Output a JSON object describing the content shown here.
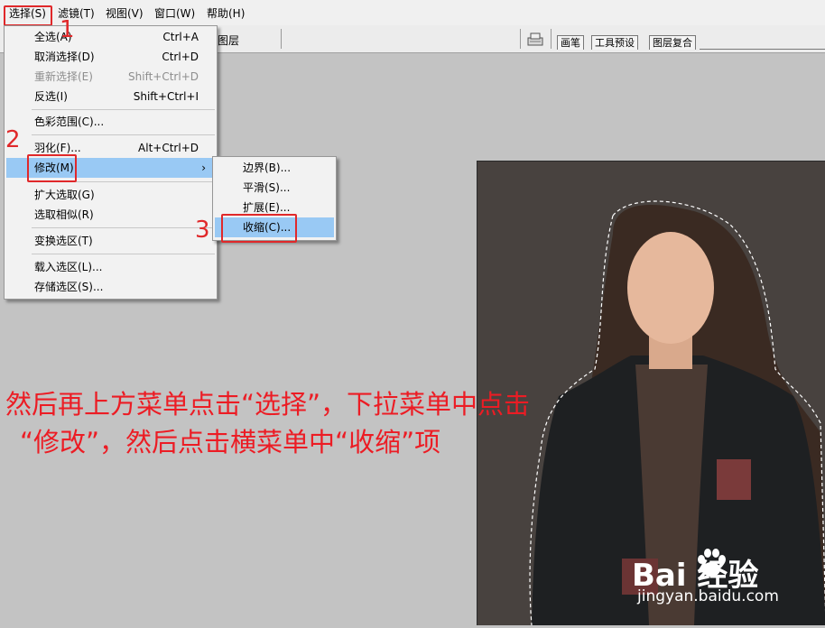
{
  "menubar": {
    "items": [
      "选择(S)",
      "滤镜(T)",
      "视图(V)",
      "窗口(W)",
      "帮助(H)"
    ]
  },
  "toolbar": {
    "layer_label": "图层",
    "panel_tabs": [
      "画笔",
      "工具预设",
      "图层复合"
    ]
  },
  "select_menu": {
    "items": [
      {
        "label": "全选(A)",
        "shortcut": "Ctrl+A",
        "disabled": false
      },
      {
        "label": "取消选择(D)",
        "shortcut": "Ctrl+D",
        "disabled": false
      },
      {
        "label": "重新选择(E)",
        "shortcut": "Shift+Ctrl+D",
        "disabled": true
      },
      {
        "label": "反选(I)",
        "shortcut": "Shift+Ctrl+I",
        "disabled": false
      },
      {
        "label": "色彩范围(C)...",
        "shortcut": "",
        "disabled": false
      },
      {
        "label": "羽化(F)...",
        "shortcut": "Alt+Ctrl+D",
        "disabled": false
      },
      {
        "label": "修改(M)",
        "shortcut": "",
        "disabled": false,
        "submenu_arrow": "›"
      },
      {
        "label": "扩大选取(G)",
        "shortcut": "",
        "disabled": false
      },
      {
        "label": "选取相似(R)",
        "shortcut": "",
        "disabled": false
      },
      {
        "label": "变换选区(T)",
        "shortcut": "",
        "disabled": false
      },
      {
        "label": "载入选区(L)...",
        "shortcut": "",
        "disabled": false
      },
      {
        "label": "存储选区(S)...",
        "shortcut": "",
        "disabled": false
      }
    ]
  },
  "modify_submenu": {
    "items": [
      "边界(B)...",
      "平滑(S)...",
      "扩展(E)...",
      "收缩(C)..."
    ]
  },
  "steps": [
    "1",
    "2",
    "3"
  ],
  "caption": {
    "line1": "然后再上方菜单点击“选择”，下拉菜单中点击",
    "line2": "“修改”，然后点击横菜单中“收缩”项"
  },
  "watermark": {
    "brand": "Bai  经验",
    "url": "jingyan.baidu.com"
  },
  "colors": {
    "accent_red": "#e0282a",
    "menu_highlight": "#99c9f4",
    "document_bg": "#48423f"
  }
}
